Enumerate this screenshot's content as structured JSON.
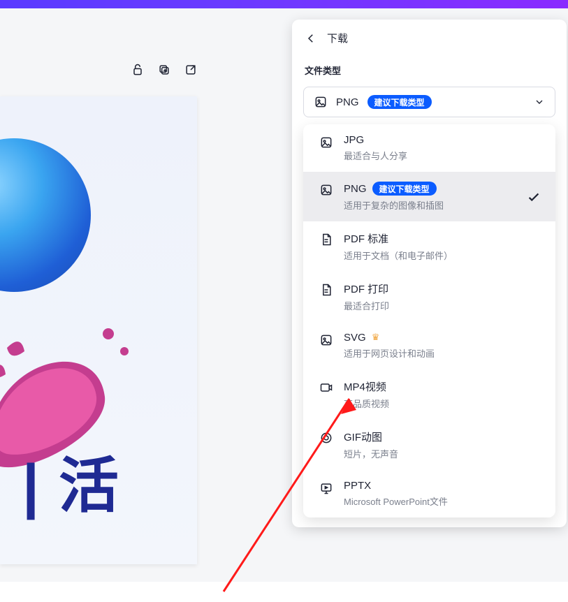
{
  "panel": {
    "title": "下载",
    "section_label": "文件类型",
    "selected": {
      "label": "PNG",
      "badge": "建议下载类型"
    }
  },
  "options": [
    {
      "kind": "image",
      "title": "JPG",
      "sub": "最适合与人分享",
      "badge": "",
      "selected": false
    },
    {
      "kind": "image",
      "title": "PNG",
      "sub": "适用于复杂的图像和插图",
      "badge": "建议下载类型",
      "selected": true
    },
    {
      "kind": "pdf",
      "title": "PDF 标准",
      "sub": "适用于文档（和电子邮件）",
      "badge": "",
      "selected": false
    },
    {
      "kind": "pdf",
      "title": "PDF 打印",
      "sub": "最适合打印",
      "badge": "",
      "selected": false
    },
    {
      "kind": "image",
      "title": "SVG",
      "sub": "适用于网页设计和动画",
      "badge": "",
      "selected": false,
      "crown": true
    },
    {
      "kind": "video",
      "title": "MP4视频",
      "sub": "高品质视频",
      "badge": "",
      "selected": false
    },
    {
      "kind": "gif",
      "title": "GIF动图",
      "sub": "短片，无声音",
      "badge": "",
      "selected": false
    },
    {
      "kind": "slides",
      "title": "PPTX",
      "sub": "Microsoft PowerPoint文件",
      "badge": "",
      "selected": false
    }
  ],
  "artboard": {
    "text": "∶| 活"
  }
}
